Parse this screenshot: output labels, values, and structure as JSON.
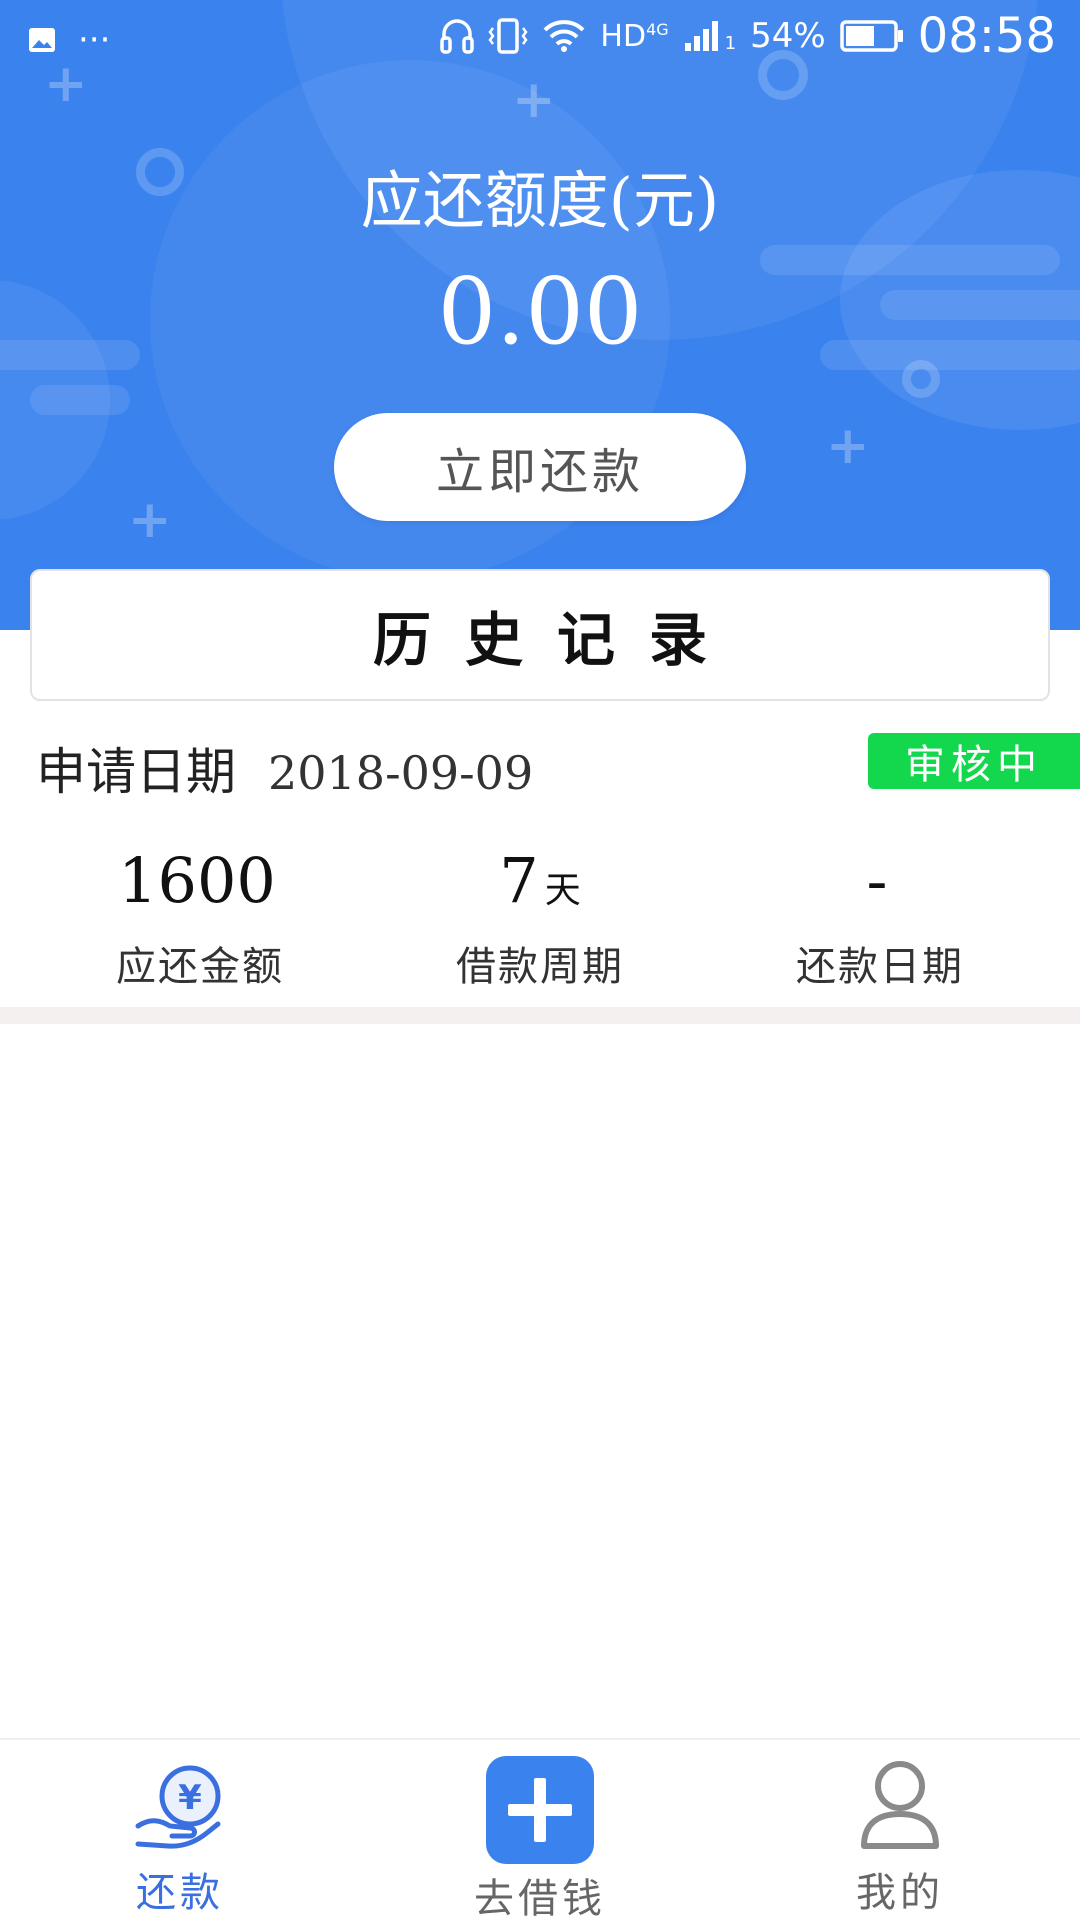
{
  "status_bar": {
    "left_dots": "···",
    "network": "HD",
    "network_sup": "4G",
    "sim_slot": "1",
    "battery": "54%",
    "time": "08:58"
  },
  "header": {
    "amount_label": "应还额度(元)",
    "amount_value": "0.00",
    "repay_button_label": "立即还款",
    "bg_color": "#3a82ee"
  },
  "history": {
    "title": "历史记录"
  },
  "record": {
    "date_label": "申请日期",
    "date_value": "2018-09-09",
    "status": "审核中",
    "status_color": "#13d74d",
    "stats": [
      {
        "value": "1600",
        "unit": "",
        "label": "应还金额"
      },
      {
        "value": "7",
        "unit": "天",
        "label": "借款周期"
      },
      {
        "value": "-",
        "unit": "",
        "label": "还款日期"
      }
    ]
  },
  "bottom_nav": {
    "items": [
      {
        "label": "还款",
        "icon": "yen-hand-icon",
        "active": true,
        "color": "#3a6fe0"
      },
      {
        "label": "去借钱",
        "icon": "plus-icon",
        "active": false,
        "color": "#666666"
      },
      {
        "label": "我的",
        "icon": "user-icon",
        "active": false,
        "color": "#666666"
      }
    ]
  }
}
